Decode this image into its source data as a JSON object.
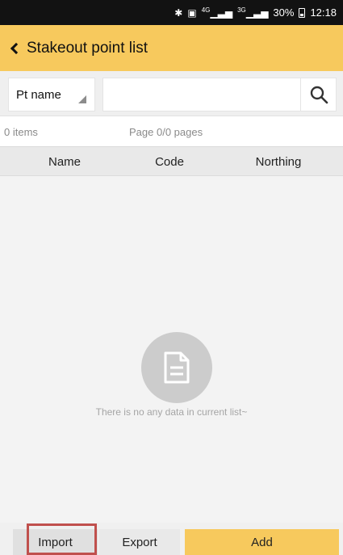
{
  "status_bar": {
    "icons": [
      "bluetooth-icon",
      "nfc-icon",
      "signal-4g-icon",
      "signal-3g-icon"
    ],
    "network_4g": "4G",
    "network_3g": "3G",
    "battery": "30%",
    "time": "12:18"
  },
  "app_bar": {
    "title": "Stakeout point list",
    "color": "#f7c95d"
  },
  "search": {
    "field_select": "Pt name",
    "value": ""
  },
  "info": {
    "count": "0 items",
    "page": "Page 0/0 pages"
  },
  "table": {
    "columns": [
      "Name",
      "Code",
      "Northing"
    ]
  },
  "empty_state": {
    "icon": "document-icon",
    "message": "There is no any data in current list~"
  },
  "actions": {
    "import": "Import",
    "export": "Export",
    "add": "Add",
    "highlight_color": "#c0504d"
  }
}
